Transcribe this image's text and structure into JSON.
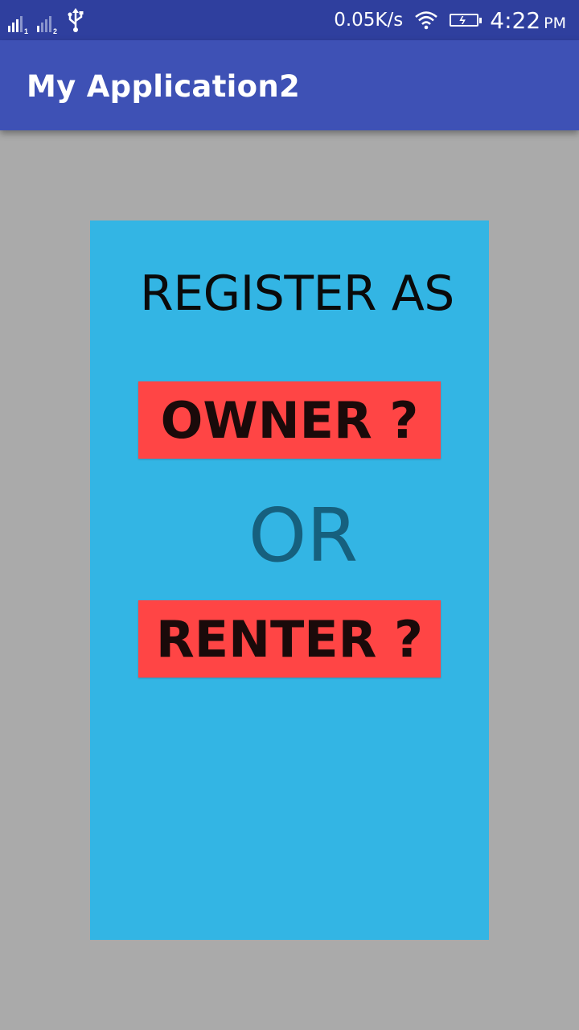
{
  "status_bar": {
    "sim1_label": "1",
    "sim2_label": "2",
    "network_speed": "0.05K/s",
    "time": "4:22",
    "ampm": "PM",
    "icons": [
      "signal-sim1-icon",
      "signal-sim2-icon",
      "usb-icon",
      "wifi-icon",
      "battery-charging-icon"
    ]
  },
  "app_bar": {
    "title": "My Application2",
    "color": "#3e51b5"
  },
  "main": {
    "card_color": "#33b5e4",
    "heading": "REGISTER AS",
    "owner_button_label": "OWNER ?",
    "separator": "OR",
    "renter_button_label": "RENTER ?",
    "button_color": "#ff4545"
  }
}
